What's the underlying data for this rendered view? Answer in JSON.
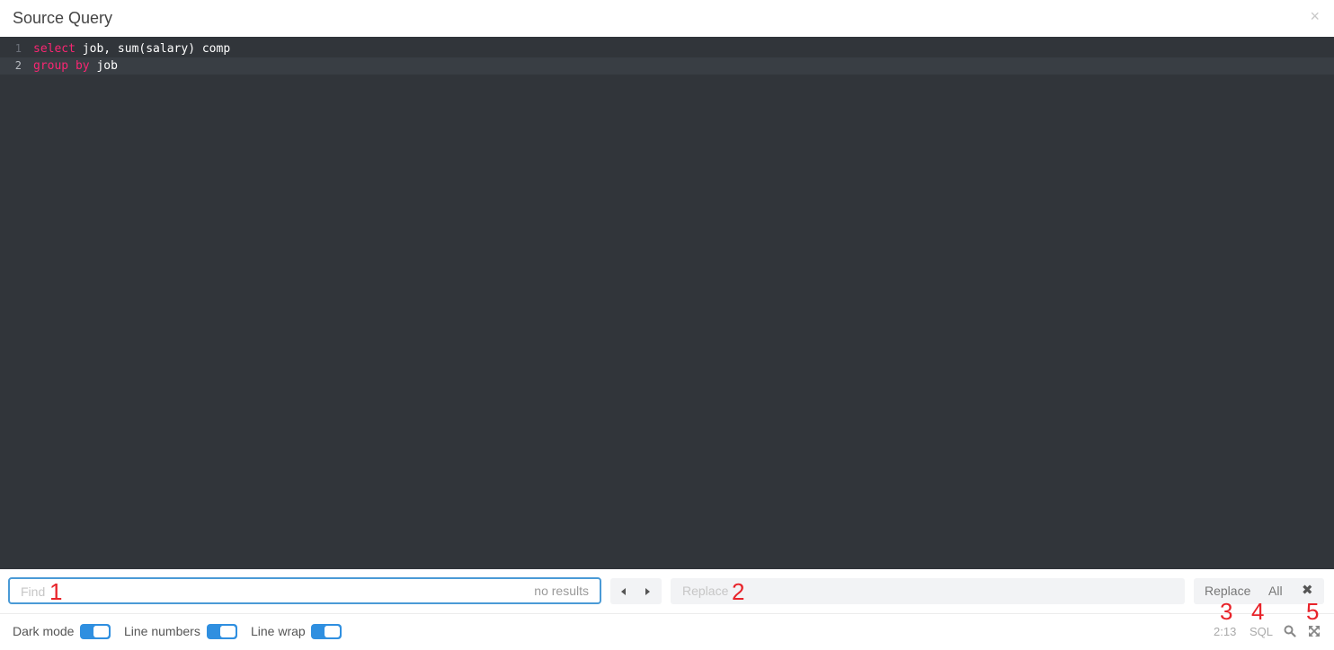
{
  "window": {
    "title": "Source Query",
    "close_glyph": "×"
  },
  "editor": {
    "lines": [
      {
        "number": "1",
        "tokens": [
          {
            "text": "select",
            "kind": "keyword"
          },
          {
            "text": " job, sum(salary) comp",
            "kind": "plain"
          }
        ]
      },
      {
        "number": "2",
        "tokens": [
          {
            "text": "group",
            "kind": "keyword"
          },
          {
            "text": " ",
            "kind": "plain"
          },
          {
            "text": "by",
            "kind": "keyword"
          },
          {
            "text": " job",
            "kind": "plain"
          }
        ]
      }
    ],
    "keyword_color": "#f92672",
    "background_color": "#31353a"
  },
  "find": {
    "placeholder": "Find",
    "count_text": "no results",
    "prev_icon": "caret-left-icon",
    "next_icon": "caret-right-icon",
    "replace_placeholder": "Replace",
    "replace_label": "Replace",
    "replace_all_label": "All",
    "close_glyph": "✖"
  },
  "options": {
    "dark_mode_label": "Dark mode",
    "line_numbers_label": "Line numbers",
    "line_wrap_label": "Line wrap",
    "toggle_color": "#2f8fe0"
  },
  "status": {
    "cursor_position": "2:13",
    "language": "SQL",
    "search_icon": "search-icon",
    "expand_icon": "expand-icon"
  },
  "annotations": [
    "1",
    "2",
    "3",
    "4",
    "5"
  ],
  "annotation_color": "#e8232a"
}
